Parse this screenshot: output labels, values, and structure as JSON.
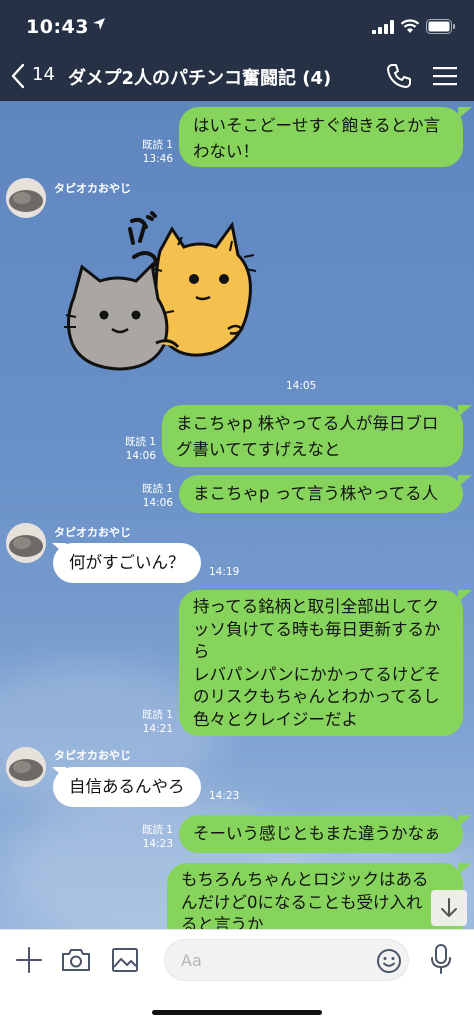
{
  "status": {
    "time": "10:43"
  },
  "header": {
    "back_count": "14",
    "title": "ダメプ2人のパチンコ奮闘記 (4)"
  },
  "messages": {
    "m1": {
      "read": "既読 1",
      "time": "13:46",
      "lines": [
        "はいそこどーせすぐ飽きるとか言",
        "わない！"
      ]
    },
    "m2": {
      "sender": "タピオカおやじ",
      "sticker": "ポン",
      "time": "14:05"
    },
    "m3": {
      "read": "既読 1",
      "time": "14:06",
      "lines": [
        "まこちゃp 株やってる人が毎日ブロ",
        "グ書いててすげえなと"
      ]
    },
    "m4": {
      "read": "既読 1",
      "time": "14:06",
      "lines": [
        "まこちゃp って言う株やってる人"
      ]
    },
    "m5": {
      "sender": "タピオカおやじ",
      "time": "14:19",
      "lines": [
        "何がすごいん？"
      ]
    },
    "m6": {
      "read": "既読 1",
      "time": "14:21",
      "lines": [
        "持ってる銘柄と取引全部出してク",
        "ッソ負けてる時も毎日更新するか",
        "ら",
        "レバパンパンにかかってるけどそ",
        "のリスクもちゃんとわかってるし",
        "色々とクレイジーだよ"
      ]
    },
    "m7": {
      "sender": "タピオカおやじ",
      "time": "14:23",
      "lines": [
        "自信あるんやろ"
      ]
    },
    "m8": {
      "read": "既読 1",
      "time": "14:23",
      "lines": [
        "そーいう感じともまた違うかなぁ"
      ]
    },
    "m9": {
      "lines": [
        "もちろんちゃんとロジックはある",
        "んだけど0になることも受け入れ",
        "ると言うか"
      ]
    }
  },
  "input": {
    "placeholder": "Aa"
  },
  "colors": {
    "header_bg": "#263145",
    "bubble_green": "#86d45b",
    "chat_bg": "#6890c7"
  }
}
